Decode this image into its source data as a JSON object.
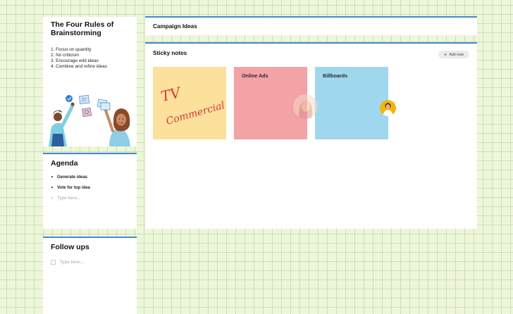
{
  "rules_card": {
    "title": "The Four Rules of Brainstorming",
    "items": [
      "1. Focus on quantity",
      "2. No criticism",
      "3. Encourage wild ideas",
      "4. Combine and refine ideas"
    ]
  },
  "agenda": {
    "title": "Agenda",
    "items": [
      "Generate ideas",
      "Vote for top idea"
    ],
    "placeholder": "Type here..."
  },
  "followups": {
    "title": "Follow ups",
    "placeholder": "Type here..."
  },
  "campaign": {
    "title": "Campaign Ideas"
  },
  "sticky_notes": {
    "title": "Sticky notes",
    "add_label": "Add note",
    "notes": [
      {
        "handwriting": [
          "TV",
          "Commercial"
        ],
        "color": "#fbe19c"
      },
      {
        "label": "Online Ads",
        "color": "#f3a2a6"
      },
      {
        "label": "Billboards",
        "color": "#9fd8ee"
      }
    ]
  },
  "colors": {
    "accent": "#3f8ad6",
    "canvas": "#eef6da",
    "grid": "#c9dfb2",
    "handwriting": "#d8343b"
  },
  "icons": {
    "add": "plus-icon",
    "checkbox": "checkbox-icon"
  }
}
